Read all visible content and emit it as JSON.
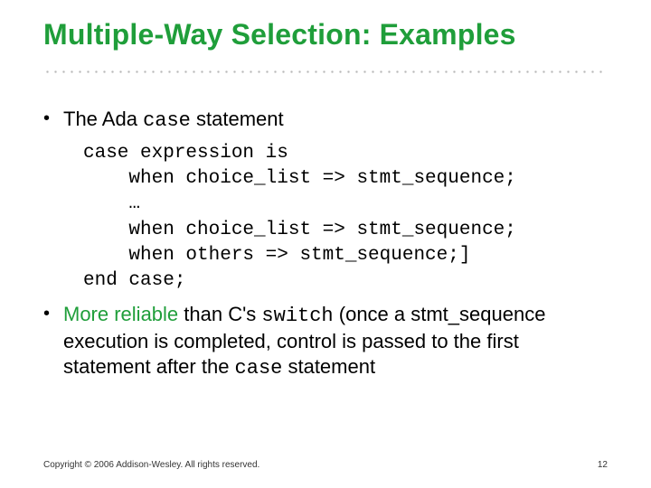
{
  "slide": {
    "title": "Multiple-Way Selection: Examples",
    "bullet1_pre": "The Ada ",
    "bullet1_code": "case",
    "bullet1_post": " statement",
    "code": {
      "l1": "case expression is",
      "l2": "    when choice_list => stmt_sequence;",
      "l3": "    …",
      "l4": "    when choice_list => stmt_sequence;",
      "l5": "    when others => stmt_sequence;]",
      "l6": "end case;"
    },
    "bullet2": {
      "a": "More reliable",
      "b": " than C's ",
      "c": "switch",
      "d": " (once a stmt_sequence execution is completed, control is passed to the first statement after the ",
      "e": "case",
      "f": " statement"
    },
    "footer": "Copyright © 2006 Addison-Wesley. All rights reserved.",
    "pagenum": "12"
  }
}
